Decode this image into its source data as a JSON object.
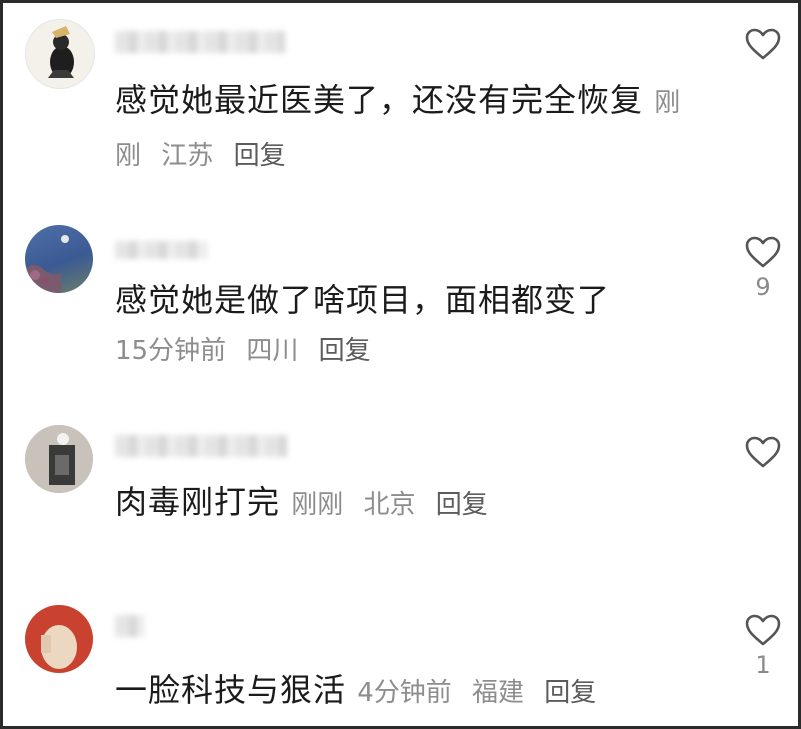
{
  "comments": [
    {
      "text": "感觉她最近医美了，还没有完全恢复",
      "time": "刚刚",
      "location": "江苏",
      "reply_label": "回复",
      "likes": ""
    },
    {
      "text": "感觉她是做了啥项目，面相都变了",
      "time": "15分钟前",
      "location": "四川",
      "reply_label": "回复",
      "likes": "9"
    },
    {
      "text": "肉毒刚打完",
      "time": "刚刚",
      "location": "北京",
      "reply_label": "回复",
      "likes": ""
    },
    {
      "text": "一脸科技与狠活",
      "time": "4分钟前",
      "location": "福建",
      "reply_label": "回复",
      "likes": "1"
    }
  ],
  "icons": {
    "like": "heart-outline-icon"
  },
  "colors": {
    "text": "#1b1b1b",
    "meta": "#8d8d8d",
    "border": "#2b2b2b"
  }
}
